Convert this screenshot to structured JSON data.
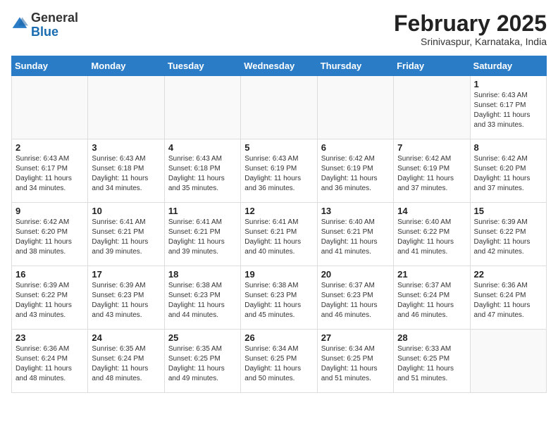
{
  "header": {
    "logo_general": "General",
    "logo_blue": "Blue",
    "month_year": "February 2025",
    "location": "Srinivaspur, Karnataka, India"
  },
  "weekdays": [
    "Sunday",
    "Monday",
    "Tuesday",
    "Wednesday",
    "Thursday",
    "Friday",
    "Saturday"
  ],
  "weeks": [
    [
      {
        "day": "",
        "info": ""
      },
      {
        "day": "",
        "info": ""
      },
      {
        "day": "",
        "info": ""
      },
      {
        "day": "",
        "info": ""
      },
      {
        "day": "",
        "info": ""
      },
      {
        "day": "",
        "info": ""
      },
      {
        "day": "1",
        "info": "Sunrise: 6:43 AM\nSunset: 6:17 PM\nDaylight: 11 hours\nand 33 minutes."
      }
    ],
    [
      {
        "day": "2",
        "info": "Sunrise: 6:43 AM\nSunset: 6:17 PM\nDaylight: 11 hours\nand 34 minutes."
      },
      {
        "day": "3",
        "info": "Sunrise: 6:43 AM\nSunset: 6:18 PM\nDaylight: 11 hours\nand 34 minutes."
      },
      {
        "day": "4",
        "info": "Sunrise: 6:43 AM\nSunset: 6:18 PM\nDaylight: 11 hours\nand 35 minutes."
      },
      {
        "day": "5",
        "info": "Sunrise: 6:43 AM\nSunset: 6:19 PM\nDaylight: 11 hours\nand 36 minutes."
      },
      {
        "day": "6",
        "info": "Sunrise: 6:42 AM\nSunset: 6:19 PM\nDaylight: 11 hours\nand 36 minutes."
      },
      {
        "day": "7",
        "info": "Sunrise: 6:42 AM\nSunset: 6:19 PM\nDaylight: 11 hours\nand 37 minutes."
      },
      {
        "day": "8",
        "info": "Sunrise: 6:42 AM\nSunset: 6:20 PM\nDaylight: 11 hours\nand 37 minutes."
      }
    ],
    [
      {
        "day": "9",
        "info": "Sunrise: 6:42 AM\nSunset: 6:20 PM\nDaylight: 11 hours\nand 38 minutes."
      },
      {
        "day": "10",
        "info": "Sunrise: 6:41 AM\nSunset: 6:21 PM\nDaylight: 11 hours\nand 39 minutes."
      },
      {
        "day": "11",
        "info": "Sunrise: 6:41 AM\nSunset: 6:21 PM\nDaylight: 11 hours\nand 39 minutes."
      },
      {
        "day": "12",
        "info": "Sunrise: 6:41 AM\nSunset: 6:21 PM\nDaylight: 11 hours\nand 40 minutes."
      },
      {
        "day": "13",
        "info": "Sunrise: 6:40 AM\nSunset: 6:21 PM\nDaylight: 11 hours\nand 41 minutes."
      },
      {
        "day": "14",
        "info": "Sunrise: 6:40 AM\nSunset: 6:22 PM\nDaylight: 11 hours\nand 41 minutes."
      },
      {
        "day": "15",
        "info": "Sunrise: 6:39 AM\nSunset: 6:22 PM\nDaylight: 11 hours\nand 42 minutes."
      }
    ],
    [
      {
        "day": "16",
        "info": "Sunrise: 6:39 AM\nSunset: 6:22 PM\nDaylight: 11 hours\nand 43 minutes."
      },
      {
        "day": "17",
        "info": "Sunrise: 6:39 AM\nSunset: 6:23 PM\nDaylight: 11 hours\nand 43 minutes."
      },
      {
        "day": "18",
        "info": "Sunrise: 6:38 AM\nSunset: 6:23 PM\nDaylight: 11 hours\nand 44 minutes."
      },
      {
        "day": "19",
        "info": "Sunrise: 6:38 AM\nSunset: 6:23 PM\nDaylight: 11 hours\nand 45 minutes."
      },
      {
        "day": "20",
        "info": "Sunrise: 6:37 AM\nSunset: 6:23 PM\nDaylight: 11 hours\nand 46 minutes."
      },
      {
        "day": "21",
        "info": "Sunrise: 6:37 AM\nSunset: 6:24 PM\nDaylight: 11 hours\nand 46 minutes."
      },
      {
        "day": "22",
        "info": "Sunrise: 6:36 AM\nSunset: 6:24 PM\nDaylight: 11 hours\nand 47 minutes."
      }
    ],
    [
      {
        "day": "23",
        "info": "Sunrise: 6:36 AM\nSunset: 6:24 PM\nDaylight: 11 hours\nand 48 minutes."
      },
      {
        "day": "24",
        "info": "Sunrise: 6:35 AM\nSunset: 6:24 PM\nDaylight: 11 hours\nand 48 minutes."
      },
      {
        "day": "25",
        "info": "Sunrise: 6:35 AM\nSunset: 6:25 PM\nDaylight: 11 hours\nand 49 minutes."
      },
      {
        "day": "26",
        "info": "Sunrise: 6:34 AM\nSunset: 6:25 PM\nDaylight: 11 hours\nand 50 minutes."
      },
      {
        "day": "27",
        "info": "Sunrise: 6:34 AM\nSunset: 6:25 PM\nDaylight: 11 hours\nand 51 minutes."
      },
      {
        "day": "28",
        "info": "Sunrise: 6:33 AM\nSunset: 6:25 PM\nDaylight: 11 hours\nand 51 minutes."
      },
      {
        "day": "",
        "info": ""
      }
    ]
  ]
}
